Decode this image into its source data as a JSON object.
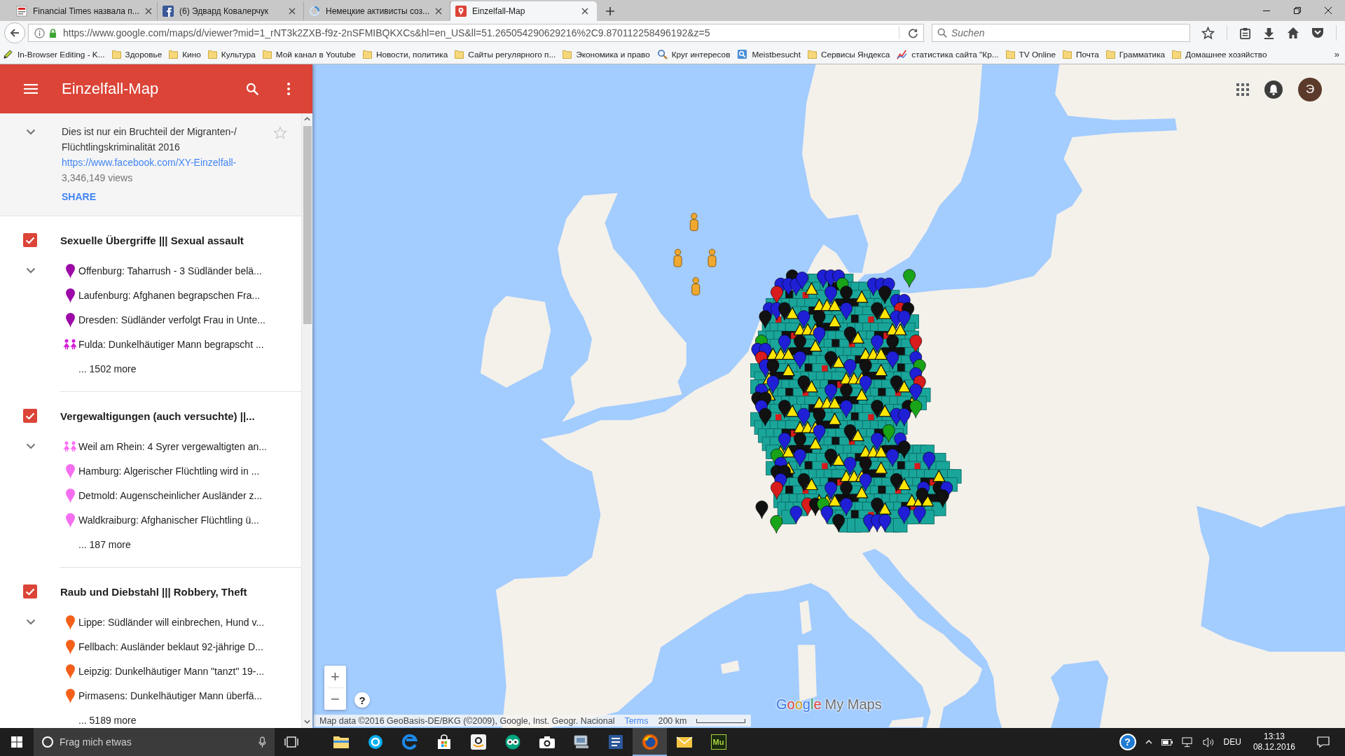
{
  "browser": {
    "tabs": [
      {
        "title": "Financial Times назвала п...",
        "kind": "newspaper",
        "selected": false
      },
      {
        "title": "(6) Эдвард Ковалерчук",
        "kind": "social",
        "selected": false
      },
      {
        "title": "Немецкие активисты соз...",
        "kind": "loading",
        "selected": false
      },
      {
        "title": "Einzelfall-Map",
        "kind": "map",
        "selected": true
      }
    ],
    "address": {
      "url": "https://www.google.com/maps/d/viewer?mid=1_rNT3k2ZXB-f9z-2nSFMIBQKXCs&hl=en_US&ll=51.265054290629216%2C9.870112258496192&z=5"
    },
    "search": {
      "placeholder": "Suchen"
    },
    "bookmarks": [
      {
        "label": "In-Browser Editing - K...",
        "kind": "pencil"
      },
      {
        "label": "Здоровье",
        "kind": "folder"
      },
      {
        "label": "Кино",
        "kind": "folder"
      },
      {
        "label": "Культура",
        "kind": "folder"
      },
      {
        "label": "Мой канал в Youtube",
        "kind": "folder"
      },
      {
        "label": "Новости, политика",
        "kind": "folder"
      },
      {
        "label": "Сайты регулярного п...",
        "kind": "folder"
      },
      {
        "label": "Экономика и право",
        "kind": "folder"
      },
      {
        "label": "Круг интересов",
        "kind": "magnifier"
      },
      {
        "label": "Meistbesucht",
        "kind": "smart"
      },
      {
        "label": "Сервисы Яндекса",
        "kind": "folder"
      },
      {
        "label": "статистика сайта \"Кр...",
        "kind": "chart"
      },
      {
        "label": "TV Online",
        "kind": "folder"
      },
      {
        "label": "Почта",
        "kind": "folder"
      },
      {
        "label": "Грамматика",
        "kind": "folder"
      },
      {
        "label": "Домашнее хозяйство",
        "kind": "folder"
      }
    ],
    "bookmarks_overflow": "»"
  },
  "sidebar": {
    "title": "Einzelfall-Map",
    "info": {
      "expanded": true,
      "starred": false,
      "description": "Dies ist nur ein Bruchteil der Migranten-/Flüchtlingskriminalität 2016",
      "link": "https://www.facebook.com/XY-Einzelfall-",
      "views": "3,346,149 views",
      "share": "SHARE"
    },
    "layers": [
      {
        "title": "Sexuelle Übergriffe ||| Sexual assault",
        "checked": true,
        "expanded": true,
        "items": [
          {
            "kind": "pin",
            "color": "#9c0aa8",
            "label": "Offenburg: Taharrush - 3 Südländer belä..."
          },
          {
            "kind": "pin",
            "color": "#9c0aa8",
            "label": "Laufenburg: Afghanen begrapschen Fra..."
          },
          {
            "kind": "pin",
            "color": "#9c0aa8",
            "label": "Dresden: Südländer verfolgt Frau in Unte..."
          },
          {
            "kind": "people",
            "color": "#d61ed6",
            "label": "Fulda: Dunkelhäutiger Mann begrapscht ..."
          }
        ],
        "more": "... 1502 more"
      },
      {
        "title": "Vergewaltigungen (auch versuchte) ||...",
        "checked": true,
        "expanded": true,
        "items": [
          {
            "kind": "people",
            "color": "#ff6cf5",
            "label": "Weil am Rhein: 4 Syrer vergewaltigten an..."
          },
          {
            "kind": "pin",
            "color": "#f46ef0",
            "label": "Hamburg: Algerischer Flüchtling wird in ..."
          },
          {
            "kind": "pin",
            "color": "#f46ef0",
            "label": "Detmold: Augenscheinlicher Ausländer z..."
          },
          {
            "kind": "pin",
            "color": "#f46ef0",
            "label": "Waldkraiburg: Afghanischer Flüchtling ü..."
          }
        ],
        "more": "... 187 more"
      },
      {
        "title": "Raub und Diebstahl ||| Robbery, Theft",
        "checked": true,
        "expanded": true,
        "items": [
          {
            "kind": "pin",
            "color": "#f4601a",
            "label": "Lippe: Südländer will einbrechen, Hund v..."
          },
          {
            "kind": "pin",
            "color": "#f4601a",
            "label": "Fellbach: Ausländer beklaut 92-jährige D..."
          },
          {
            "kind": "pin",
            "color": "#f4601a",
            "label": "Leipzig: Dunkelhäutiger Mann \"tanzt\" 19-..."
          },
          {
            "kind": "pin",
            "color": "#f4601a",
            "label": "Pirmasens: Dunkelhäutiger Mann überfä..."
          }
        ],
        "more": "... 5189 more"
      }
    ]
  },
  "map": {
    "account": {
      "initial": "Э"
    },
    "zoom_in": "+",
    "zoom_out": "−",
    "help": "?",
    "attribution": "Map data ©2016 GeoBasis-DE/BKG (©2009), Google, Inst. Geogr. Nacional",
    "terms": "Terms",
    "scale": "200 km",
    "logo": {
      "brand": "Google",
      "product": "My Maps"
    }
  },
  "taskbar": {
    "search": {
      "placeholder": "Frag mich etwas"
    },
    "apps": [
      {
        "kind": "explorer",
        "selected": false
      },
      {
        "kind": "skype",
        "selected": false
      },
      {
        "kind": "edge",
        "selected": false
      },
      {
        "kind": "store",
        "selected": false
      },
      {
        "kind": "amazon",
        "selected": false
      },
      {
        "kind": "tripadvisor",
        "selected": false
      },
      {
        "kind": "camera",
        "selected": false
      },
      {
        "kind": "scanner",
        "selected": false
      },
      {
        "kind": "word",
        "selected": false
      },
      {
        "kind": "firefox",
        "selected": true
      },
      {
        "kind": "mail",
        "selected": false
      },
      {
        "kind": "muse",
        "label": "Mu",
        "selected": false
      }
    ],
    "tray": {
      "help": "?",
      "language": "DEU",
      "time": "13:13",
      "date": "08.12.2016"
    }
  }
}
